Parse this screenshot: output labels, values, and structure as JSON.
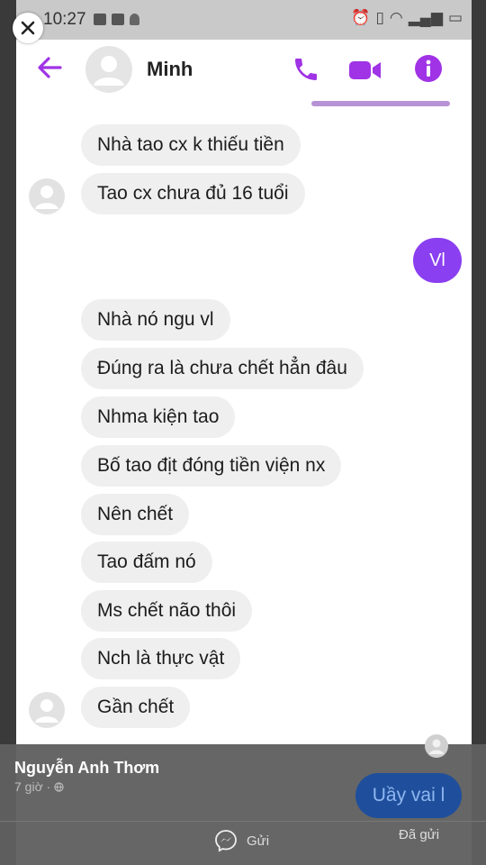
{
  "status_bar": {
    "time": "10:27"
  },
  "header": {
    "contact_name": "Minh"
  },
  "messages": {
    "received_top": [
      "Nhà tao cx k thiếu tiền",
      "Tao cx chưa đủ 16 tuổi"
    ],
    "sent": "Vl",
    "received_bottom": [
      "Nhà nó ngu vl",
      "Đúng ra là chưa chết hẳn đâu",
      "Nhma kiện tao",
      "Bố tao địt đóng tiền viện nx",
      "Nên chết",
      "Tao đấm nó",
      "Ms chết não thôi",
      "Nch là thực vật",
      "Gần chết"
    ]
  },
  "comment_overlay": {
    "commenter_name": "Nguyễn Anh Thơm",
    "time": "7 giờ ·",
    "reply_text": "Uầy vai l",
    "send_label": "Gửi",
    "sent_status": "Đã gửi"
  },
  "colors": {
    "accent": "#a033e6",
    "sent_bubble": "#8a3ff0",
    "overlay": "#606060",
    "reply_bubble": "#1f4f9c"
  },
  "icons": [
    "close-icon",
    "back-arrow-icon",
    "phone-icon",
    "video-camera-icon",
    "info-icon",
    "messenger-icon",
    "globe-icon"
  ]
}
